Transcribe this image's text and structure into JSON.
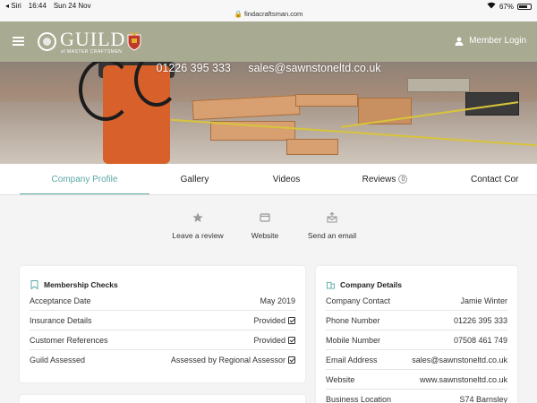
{
  "status": {
    "carrier": "◂ Siri",
    "time": "16:44",
    "date": "Sun 24 Nov",
    "url": "🔒 findacraftsman.com",
    "battery": "67%",
    "battery_level": 0.67
  },
  "header": {
    "logo_text": "GUILD",
    "logo_sub": "of MASTER CRAFTSMEN",
    "member_login": "Member Login"
  },
  "hero": {
    "phone": "01226 395 333",
    "email": "sales@sawnstoneltd.co.uk"
  },
  "tabs": [
    {
      "label": "Company Profile",
      "active": true
    },
    {
      "label": "Gallery"
    },
    {
      "label": "Videos"
    },
    {
      "label": "Reviews",
      "badge": "0"
    },
    {
      "label": "Contact Cor"
    }
  ],
  "actions": [
    {
      "label": "Leave a review",
      "icon": "star-icon"
    },
    {
      "label": "Website",
      "icon": "browser-icon"
    },
    {
      "label": "Send an email",
      "icon": "email-icon"
    }
  ],
  "membership": {
    "title": "Membership Checks",
    "rows": [
      {
        "label": "Acceptance Date",
        "value": "May 2019",
        "check": false
      },
      {
        "label": "Insurance Details",
        "value": "Provided",
        "check": true
      },
      {
        "label": "Customer References",
        "value": "Provided",
        "check": true
      },
      {
        "label": "Guild Assessed",
        "value": "Assessed by Regional Assessor",
        "check": true
      }
    ]
  },
  "company": {
    "title": "Company Details",
    "rows": [
      {
        "label": "Company Contact",
        "value": "Jamie Winter"
      },
      {
        "label": "Phone Number",
        "value": "01226 395 333"
      },
      {
        "label": "Mobile Number",
        "value": "07508 461 749"
      },
      {
        "label": "Email Address",
        "value": "sales@sawnstoneltd.co.uk"
      },
      {
        "label": "Website",
        "value": "www.sawnstoneltd.co.uk"
      },
      {
        "label": "Business Location",
        "value": "S74 Barnsley"
      }
    ]
  },
  "colors": {
    "header_bg": "#a8aa91",
    "accent": "#5aa8a4"
  }
}
